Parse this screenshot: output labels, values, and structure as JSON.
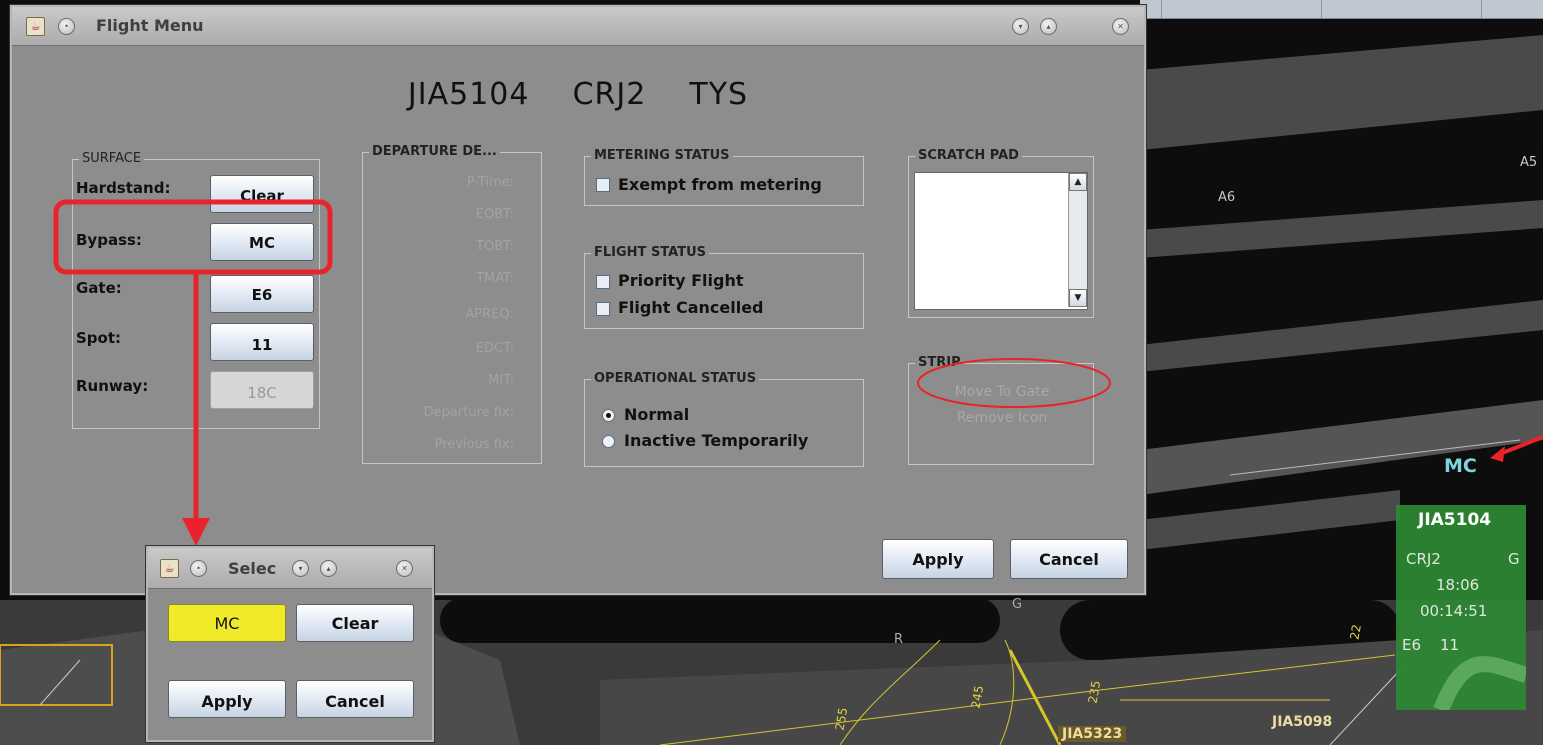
{
  "main_dialog": {
    "title": "Flight Menu",
    "header": {
      "callsign": "JIA5104",
      "aircraft": "CRJ2",
      "destination": "TYS"
    },
    "surface": {
      "legend": "SURFACE",
      "hardstand_label": "Hardstand:",
      "hardstand_value": "Clear",
      "bypass_label": "Bypass:",
      "bypass_value": "MC",
      "gate_label": "Gate:",
      "gate_value": "E6",
      "spot_label": "Spot:",
      "spot_value": "11",
      "runway_label": "Runway:",
      "runway_value": "18C"
    },
    "departure": {
      "legend": "DEPARTURE DE...",
      "fields": [
        "P-Time:",
        "EOBT:",
        "TOBT:",
        "TMAT:",
        "APREQ:",
        "EDCT:",
        "MIT:",
        "Departure fix:",
        "Previous fix:"
      ]
    },
    "metering": {
      "legend": "METERING STATUS",
      "exempt_label": "Exempt from metering"
    },
    "flight_status": {
      "legend": "FLIGHT STATUS",
      "priority_label": "Priority Flight",
      "cancelled_label": "Flight Cancelled"
    },
    "operational": {
      "legend": "OPERATIONAL STATUS",
      "normal_label": "Normal",
      "inactive_label": "Inactive Temporarily",
      "selected": "Normal"
    },
    "scratch_pad": {
      "legend": "SCRATCH PAD",
      "value": ""
    },
    "strip": {
      "legend": "STRIP",
      "move_to_gate": "Move To Gate",
      "remove_icon": "Remove Icon"
    },
    "apply_label": "Apply",
    "cancel_label": "Cancel"
  },
  "select_dialog": {
    "title": "Selec",
    "selected_value": "MC",
    "clear_label": "Clear",
    "apply_label": "Apply",
    "cancel_label": "Cancel"
  },
  "map": {
    "bypass_tag": "MC",
    "taxiway_labels": [
      "A6",
      "A5",
      "R",
      "G",
      "22",
      "235",
      "245",
      "255"
    ],
    "data_block": {
      "callsign": "JIA5104",
      "aircraft": "CRJ2",
      "col": "G",
      "time1": "18:06",
      "time2": "00:14:51",
      "gate": "E6",
      "spot": "11"
    },
    "other_flights": [
      "JIA5323",
      "JIA5098"
    ]
  },
  "colors": {
    "annotation_red": "#e8232b",
    "strip_green": "#2c8a33",
    "highlight_yellow": "#f0ea2a",
    "window_gray": "#8d8d8d",
    "tag_cyan": "#7fd4e0"
  }
}
